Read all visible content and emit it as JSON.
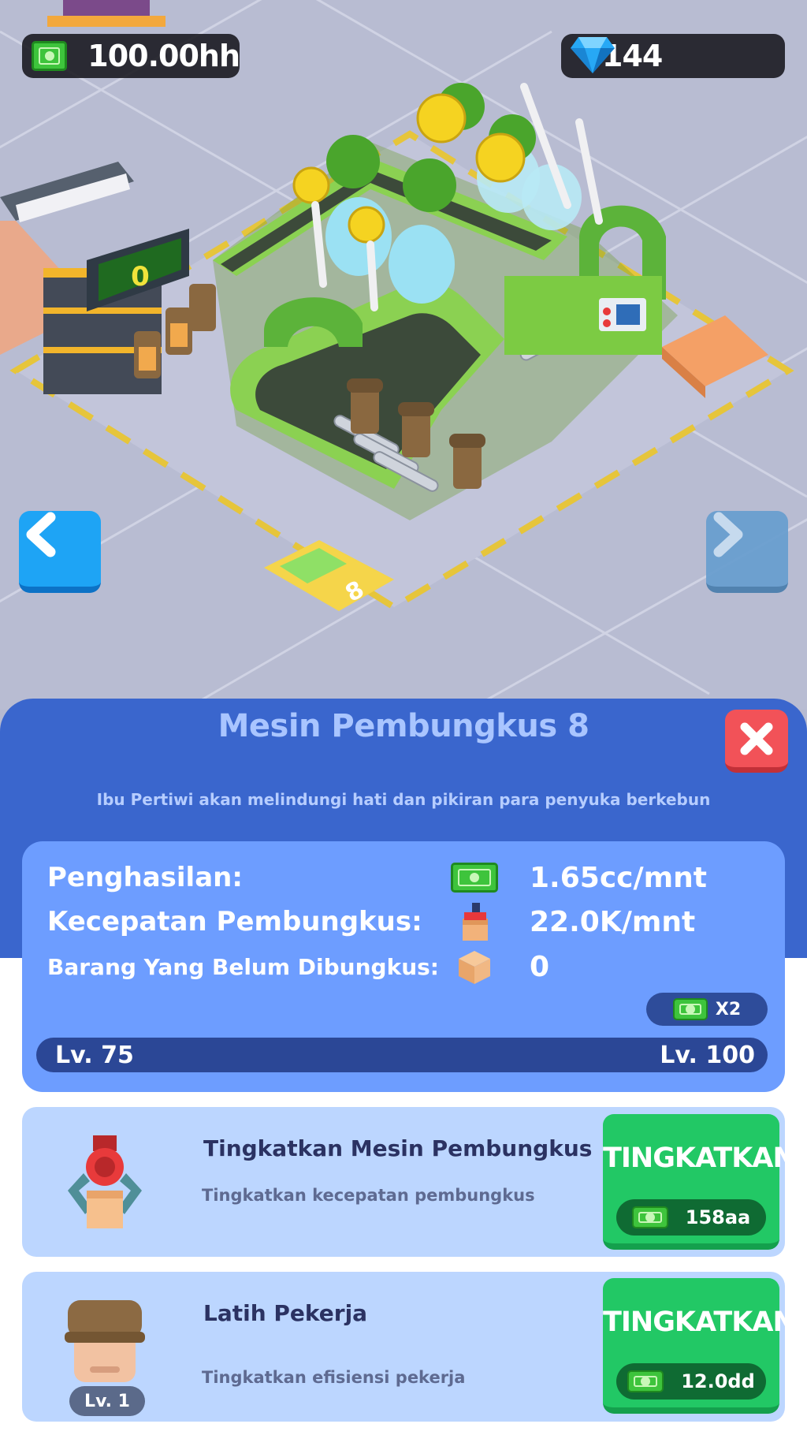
{
  "hud": {
    "money": "100.00hh",
    "gems": "144",
    "money_icon": "cash-icon",
    "gem_icon": "diamond-icon"
  },
  "scene": {
    "counter_display": "0",
    "station_number": "8"
  },
  "panel": {
    "title": "Mesin Pembungkus 8",
    "description": "Ibu Pertiwi akan melindungi hati dan pikiran para penyuka berkebun",
    "stats": {
      "income_label": "Penghasilan:",
      "income_value": "1.65cc/mnt",
      "speed_label": "Kecepatan Pembungkus:",
      "speed_value": "22.0K/mnt",
      "unpacked_label": "Barang Yang Belum Dibungkus:",
      "unpacked_value": "0"
    },
    "boost_label": "X2",
    "level_current": "Lv. 75",
    "level_next": "Lv. 100",
    "level_progress": 0
  },
  "upgrades": [
    {
      "title": "Tingkatkan Mesin Pembungkus",
      "subtitle": "Tingkatkan kecepatan pembungkus",
      "button_label": "TINGKATKAN",
      "cost": "158aa"
    },
    {
      "title": "Latih Pekerja",
      "subtitle": "Tingkatkan efisiensi pekerja",
      "button_label": "TINGKATKAN",
      "cost": "12.0dd",
      "badge": "Lv. 1"
    }
  ],
  "colors": {
    "panel": "#3a66cd",
    "stats_card": "#6d9dff",
    "upgrade_button": "#22c865",
    "close_button": "#f25258",
    "nav_active": "#1ea4f5"
  }
}
